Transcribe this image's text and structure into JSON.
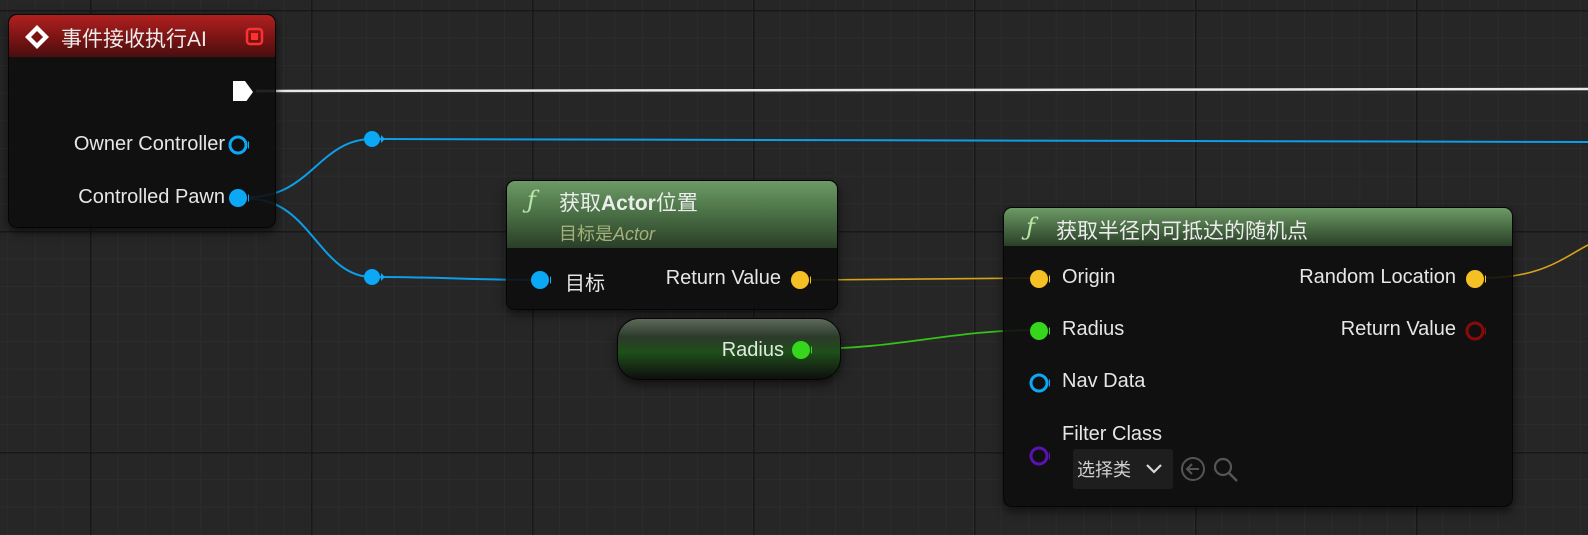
{
  "event_node": {
    "title": "事件接收执行AI",
    "header_color": "#8a1a1a",
    "pins": {
      "owner_controller": "Owner Controller",
      "controlled_pawn": "Controlled Pawn"
    }
  },
  "get_actor_location": {
    "title_prefix": "获取",
    "title_bold": "Actor",
    "title_suffix": "位置",
    "subtitle_prefix": "目标是",
    "subtitle_italic": "Actor",
    "pins": {
      "target": "目标",
      "return_value": "Return Value"
    }
  },
  "radius_var": {
    "label": "Radius"
  },
  "random_point": {
    "title": "获取半径内可抵达的随机点",
    "pins": {
      "origin": "Origin",
      "radius": "Radius",
      "nav_data": "Nav Data",
      "filter_class": "Filter Class",
      "random_location": "Random Location",
      "return_value": "Return Value"
    },
    "filter_dropdown": "选择类"
  },
  "colors": {
    "exec": "#ffffff",
    "object": "#0aa8f5",
    "vector": "#f5c024",
    "float": "#35d61b",
    "bool": "#8a0a0a",
    "class": "#5a12b5"
  }
}
